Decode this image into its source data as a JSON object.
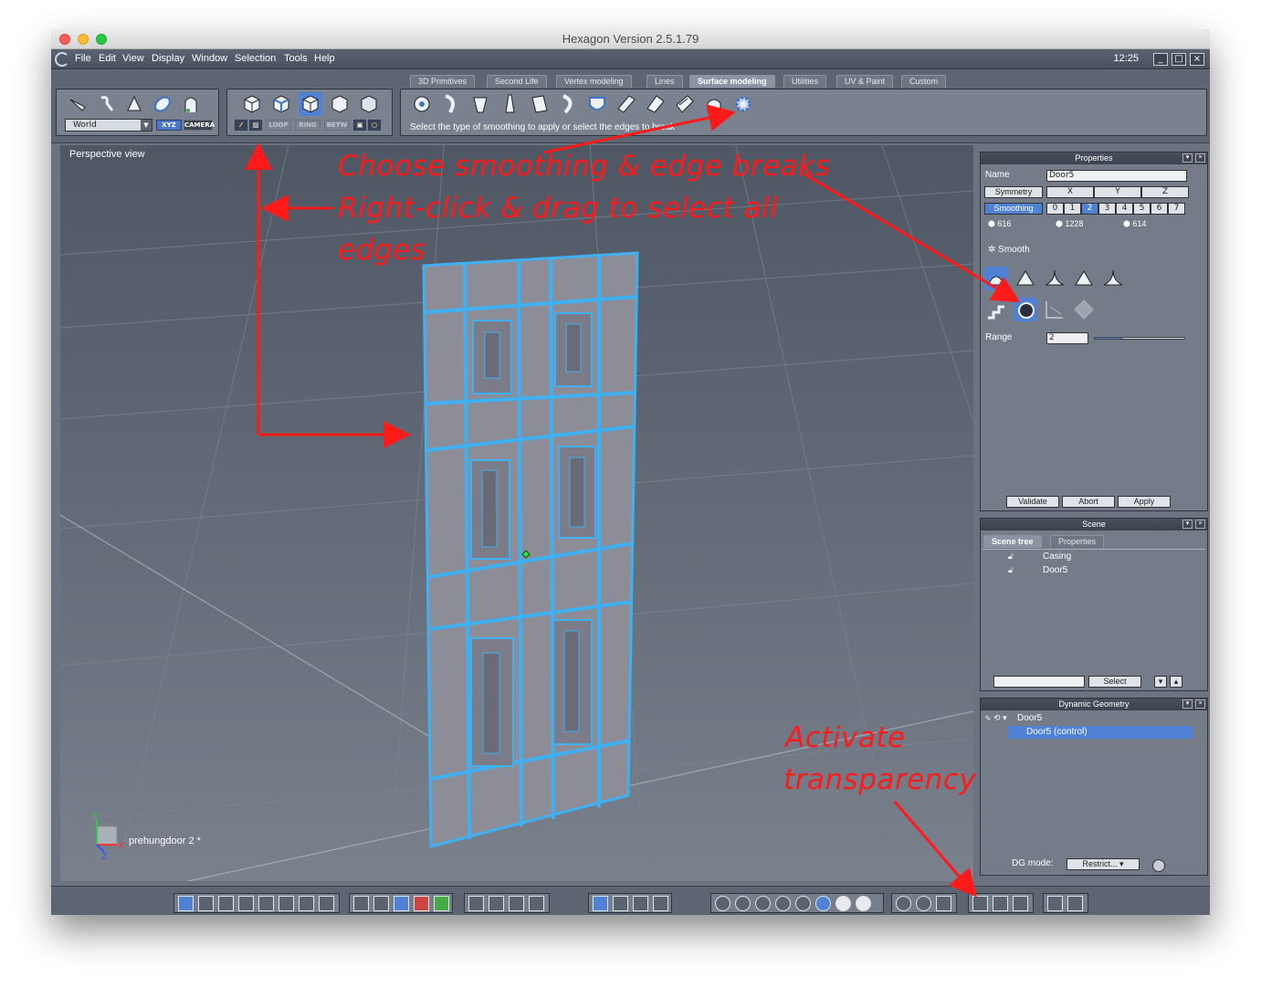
{
  "window": {
    "title": "Hexagon Version 2.5.1.79",
    "clock": "12:25"
  },
  "menu": [
    "File",
    "Edit",
    "View",
    "Display",
    "Window",
    "Selection",
    "Tools",
    "Help"
  ],
  "tabs": [
    "3D Primitives",
    "Second Life",
    "Vertex modeling",
    "Lines",
    "Surface modeling",
    "Utilities",
    "UV & Paint",
    "Custom"
  ],
  "active_tab": "Surface modeling",
  "toolbar": {
    "world_select": "World",
    "xyz": "XYZ",
    "camera": "CAMERA",
    "loop": "LOOP",
    "ring": "RING",
    "betw": "BETW",
    "hint": "Select the type of smoothing to apply or select the edges to break"
  },
  "viewport": {
    "label": "Perspective view",
    "scene_label": "prehungdoor 2 *",
    "axis_y": "Y",
    "axis_x": "X",
    "axis_z": "Z"
  },
  "properties": {
    "title": "Properties",
    "name_label": "Name",
    "name_value": "Door5",
    "symmetry": "Symmetry",
    "axes": [
      "X",
      "Y",
      "Z"
    ],
    "smoothing": "Smoothing",
    "levels": [
      "0",
      "1",
      "2",
      "3",
      "4",
      "5",
      "6",
      "7"
    ],
    "active_level": "2",
    "counts": [
      "616",
      "1228",
      "614"
    ],
    "smooth_label": "Smooth",
    "range_label": "Range",
    "range_value": "2",
    "range_fraction": 0.32,
    "validate": "Validate",
    "abort": "Abort",
    "apply": "Apply"
  },
  "scene": {
    "title": "Scene",
    "tabs": [
      "Scene tree",
      "Properties"
    ],
    "items": [
      "Casing",
      "Door5"
    ],
    "select": "Select"
  },
  "dynamic_geometry": {
    "title": "Dynamic Geometry",
    "items": [
      "Door5",
      "Door5 (control)"
    ],
    "dg_mode_label": "DG mode:",
    "dg_mode_value": "Restrict..."
  },
  "annotations": {
    "a1": "Choose smoothing & edge breaks",
    "a2": "Right-click & drag to select all",
    "a3": "edges",
    "a4": "Activate",
    "a5": "transparency"
  },
  "colors": {
    "accent": "#4f82d4",
    "annotation": "#ff1a1a",
    "wireframe": "#3fb1f2"
  }
}
